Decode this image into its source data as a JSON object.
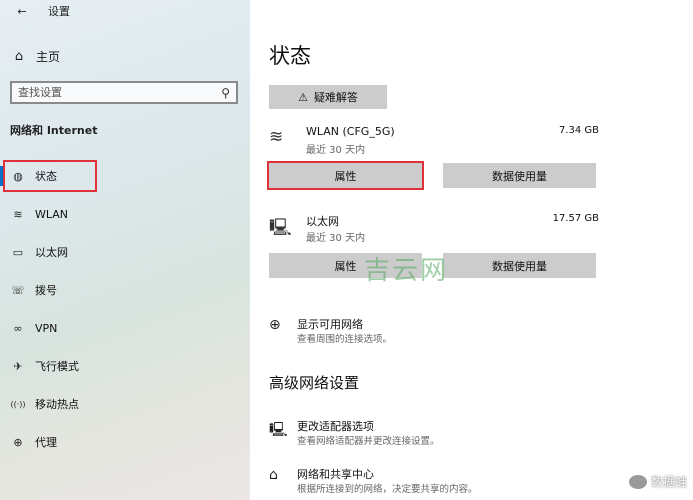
{
  "window": {
    "back_icon": "←",
    "title": "设置"
  },
  "sidebar": {
    "home": {
      "icon": "⌂",
      "label": "主页"
    },
    "search": {
      "placeholder": "查找设置",
      "icon": "⚲"
    },
    "section_title": "网络和 Internet",
    "items": [
      {
        "icon": "◍",
        "label": "状态",
        "active": true
      },
      {
        "icon": "≋",
        "label": "WLAN"
      },
      {
        "icon": "▭",
        "label": "以太网"
      },
      {
        "icon": "☏",
        "label": "拨号"
      },
      {
        "icon": "∞",
        "label": "VPN"
      },
      {
        "icon": "✈",
        "label": "飞行模式"
      },
      {
        "icon": "((·))",
        "label": "移动热点"
      },
      {
        "icon": "⊕",
        "label": "代理"
      }
    ]
  },
  "main": {
    "title": "状态",
    "troubleshoot": {
      "icon": "⚠",
      "label": "疑难解答"
    },
    "networks": [
      {
        "icon": "≋",
        "name": "WLAN (CFG_5G)",
        "sub": "最近 30 天内",
        "size": "7.34 GB",
        "props_label": "属性",
        "usage_label": "数据使用量"
      },
      {
        "icon": "🖳",
        "name": "以太网",
        "sub": "最近 30 天内",
        "size": "17.57 GB",
        "props_label": "属性",
        "usage_label": "数据使用量"
      }
    ],
    "show_networks": {
      "icon": "⊕",
      "title": "显示可用网络",
      "desc": "查看周围的连接选项。"
    },
    "advanced_title": "高级网络设置",
    "adapter": {
      "icon": "🖳",
      "title": "更改适配器选项",
      "desc": "查看网络适配器并更改连接设置。"
    },
    "sharing": {
      "icon": "⌂",
      "title": "网络和共享中心",
      "desc": "根据所连接到的网络，决定要共享的内容。"
    }
  },
  "watermark": "吉云网",
  "corner_watermark": "数据蛙"
}
